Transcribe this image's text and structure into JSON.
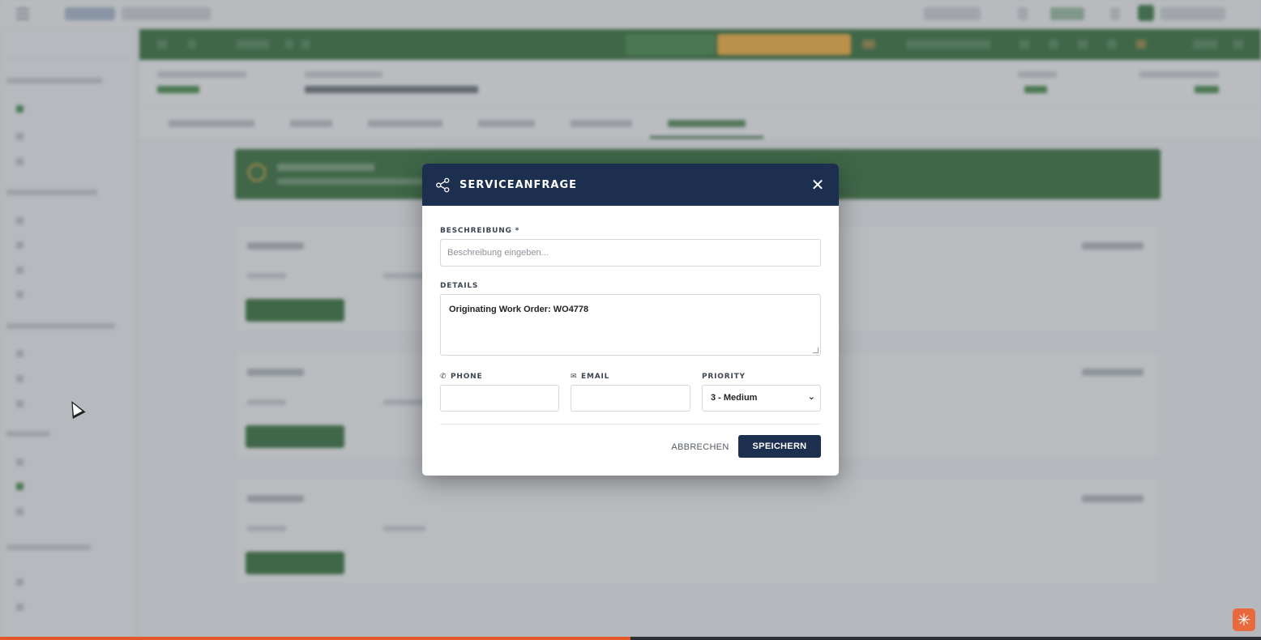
{
  "modal": {
    "title": "SERVICEANFRAGE",
    "close_glyph": "✕",
    "share_icon": "share-icon",
    "description": {
      "label": "BESCHREIBUNG *",
      "placeholder": "Beschreibung eingeben...",
      "value": ""
    },
    "details": {
      "label": "DETAILS",
      "value": "Originating Work Order: WO4778"
    },
    "phone": {
      "label": "PHONE",
      "icon": "phone-icon",
      "value": ""
    },
    "email": {
      "label": "EMAIL",
      "icon": "mail-icon",
      "value": ""
    },
    "priority": {
      "label": "PRIORITY",
      "selected": "3 - Medium"
    },
    "cancel_label": "ABBRECHEN",
    "save_label": "SPEICHERN",
    "colors": {
      "header": "#1c2f4f",
      "save_button": "#1c2f4f"
    }
  },
  "background": {
    "colors": {
      "toolbar": "#1b5e20",
      "action_orange": "#f9a825",
      "progress": "#e2562a"
    }
  },
  "video_progress": 0.5,
  "fab_icon": "asterisk-icon"
}
